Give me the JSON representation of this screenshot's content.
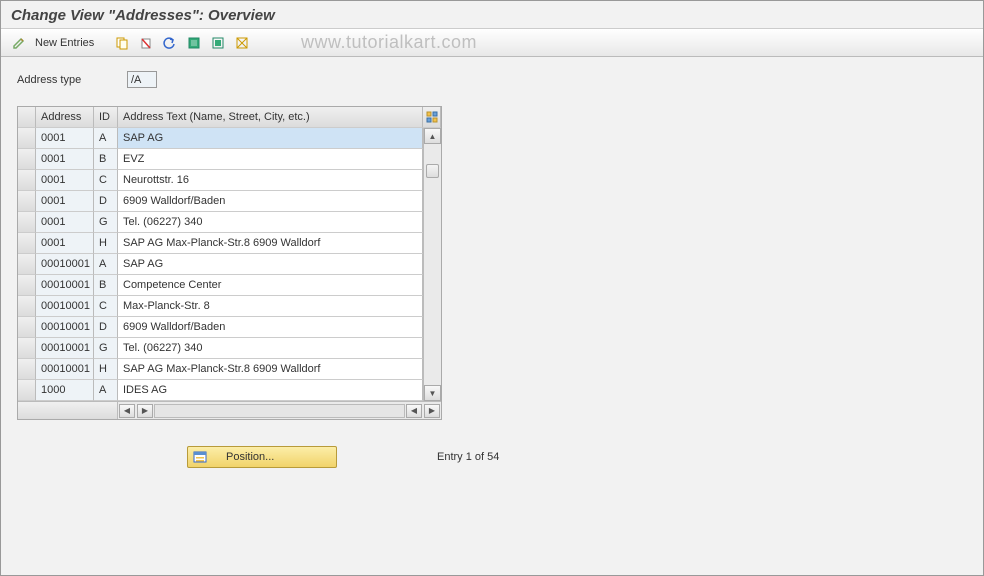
{
  "title": "Change View \"Addresses\": Overview",
  "toolbar": {
    "new_entries": "New Entries"
  },
  "field": {
    "label": "Address type",
    "value": "/A"
  },
  "table": {
    "headers": {
      "c1": "Address",
      "c2": "ID",
      "c3": "Address Text (Name, Street, City, etc.)"
    },
    "rows": [
      {
        "addr": "0001",
        "id": "A",
        "text": "SAP AG",
        "selected": true
      },
      {
        "addr": "0001",
        "id": "B",
        "text": "EVZ"
      },
      {
        "addr": "0001",
        "id": "C",
        "text": "Neurottstr. 16"
      },
      {
        "addr": "0001",
        "id": "D",
        "text": "6909   Walldorf/Baden"
      },
      {
        "addr": "0001",
        "id": "G",
        "text": "Tel. (06227) 340"
      },
      {
        "addr": "0001",
        "id": "H",
        "text": "SAP AG Max-Planck-Str.8 6909 Walldorf"
      },
      {
        "addr": "00010001",
        "id": "A",
        "text": "SAP AG"
      },
      {
        "addr": "00010001",
        "id": "B",
        "text": "Competence Center"
      },
      {
        "addr": "00010001",
        "id": "C",
        "text": "Max-Planck-Str. 8"
      },
      {
        "addr": "00010001",
        "id": "D",
        "text": "6909   Walldorf/Baden"
      },
      {
        "addr": "00010001",
        "id": "G",
        "text": "Tel. (06227) 340"
      },
      {
        "addr": "00010001",
        "id": "H",
        "text": "SAP AG Max-Planck-Str.8 6909 Walldorf"
      },
      {
        "addr": "1000",
        "id": "A",
        "text": "IDES AG"
      }
    ]
  },
  "position_button": "Position...",
  "status": "Entry 1 of 54",
  "watermark": "www.tutorialkart.com"
}
